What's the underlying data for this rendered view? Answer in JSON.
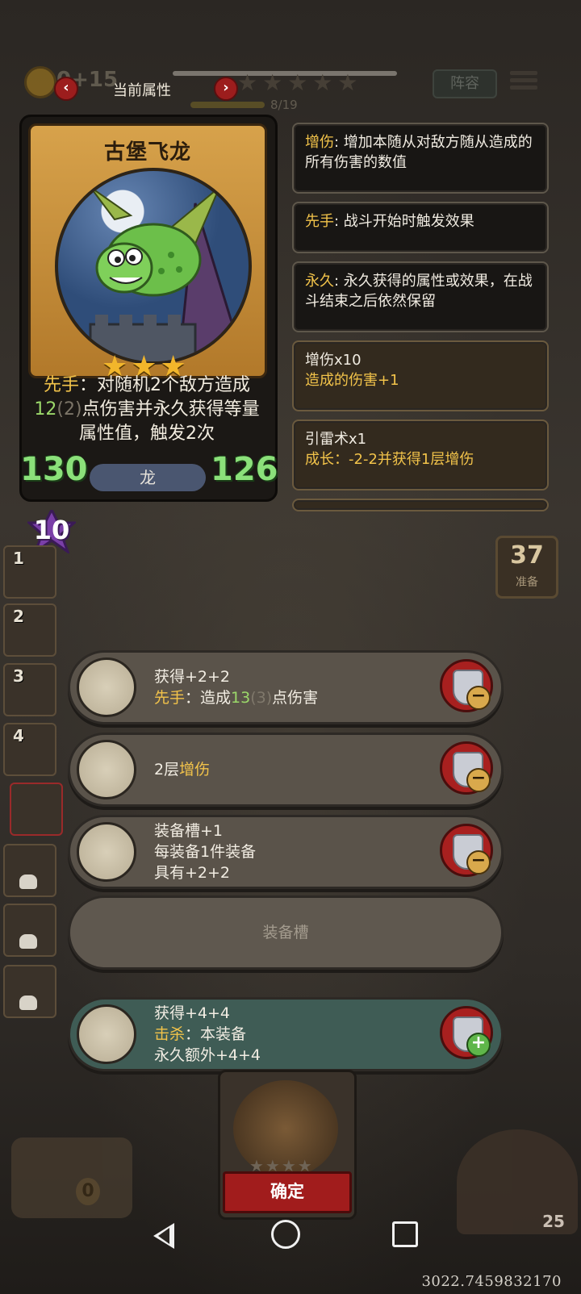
{
  "attr_panel": {
    "title": "当前属性"
  },
  "background": {
    "coin_text": "0+15",
    "progress": "8/19",
    "lineup_label": "阵容",
    "reserve_count": "37",
    "reserve_label": "准备",
    "level": "10",
    "chest_count": "0",
    "hero_hp": "25"
  },
  "card": {
    "name": "古堡飞龙",
    "stars": "★★★",
    "desc": {
      "keyword": "先手",
      "p1": "：对随机",
      "n1": "2",
      "p2": "个敌方造成",
      "n2": "12",
      "n2b": "(2)",
      "p3": "点伤害并永久获得等量属性值，触发",
      "n3": "2",
      "p4": "次"
    },
    "attack": "130",
    "health": "126",
    "type": "龙"
  },
  "keywords": [
    {
      "name": "增伤",
      "text": ": 增加本随从对敌方随从造成的所有伤害的数值"
    },
    {
      "name": "先手",
      "text": ": 战斗开始时触发效果"
    },
    {
      "name": "永久",
      "text": ": 永久获得的属性或效果，在战斗结束之后依然保留"
    }
  ],
  "buffs": [
    {
      "title": "增伤x10",
      "desc": "造成的伤害+1"
    },
    {
      "title": "引雷术x1",
      "desc_label": "成长：",
      "desc_value": "-2-2并获得1层增伤"
    }
  ],
  "equipment": [
    {
      "line1": "获得+2+2",
      "kw": "先手",
      "pre": "：造成",
      "num": "13",
      "dim": "(3)",
      "post": "点伤害"
    },
    {
      "pre": "2层",
      "kw": "增伤"
    },
    {
      "line1": "装备槽+1",
      "line2": "每装备1件装备",
      "line3": "具有+2+2"
    },
    {
      "empty_label": "装备槽"
    },
    {
      "line1": "获得+4+4",
      "kw": "击杀",
      "line2_rest": "：本装备",
      "line3": "永久额外+4+4"
    }
  ],
  "slots": [
    "1",
    "2",
    "3",
    "4"
  ],
  "confirm_label": "确定",
  "coords_text": "3022.7459832170",
  "icons": {
    "prev": "chevron-left-icon",
    "next": "chevron-right-icon",
    "remove": "shield-minus-icon",
    "add": "shield-plus-icon"
  }
}
